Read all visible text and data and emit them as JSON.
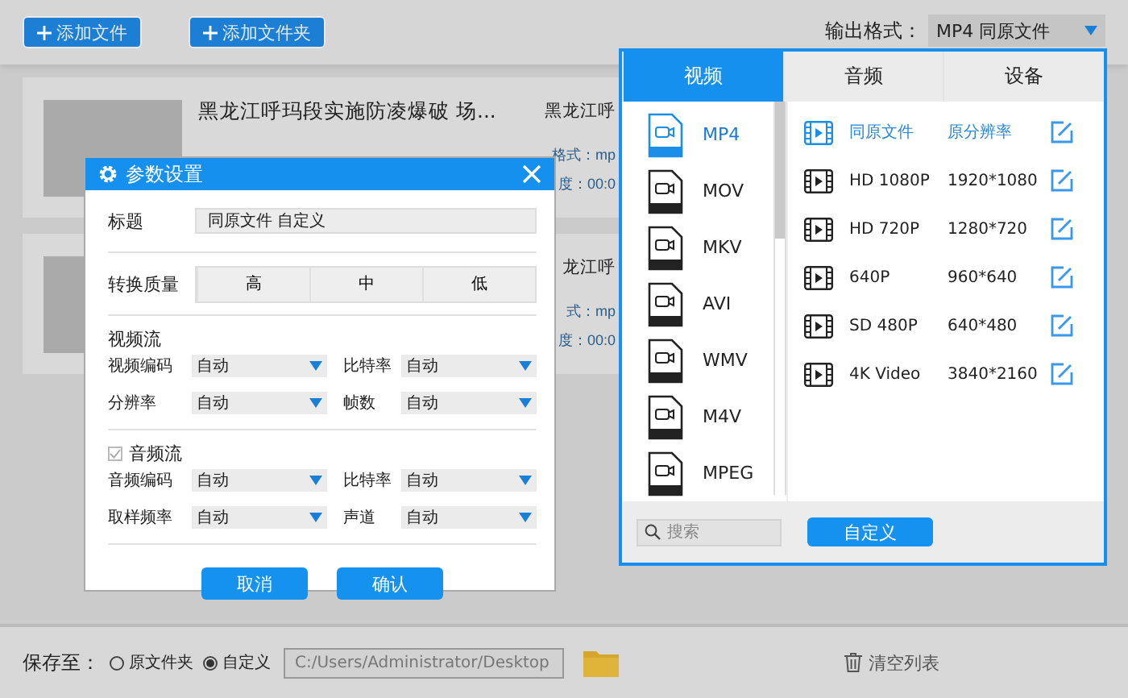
{
  "toolbar": {
    "buttons": [
      {
        "label": "添加文件"
      },
      {
        "label": "添加文件夹"
      }
    ],
    "output_format": {
      "label": "输出格式：",
      "value": "MP4  同原文件"
    }
  },
  "files": [
    {
      "title": "黑龙江呼玛段实施防凌爆破 场...",
      "title_2": "黑龙江呼",
      "detail": "格式：mp",
      "detail_2": "度：00:0"
    },
    {
      "title_2": "龙江呼",
      "detail": "式：mp",
      "detail_2": "度：00:0"
    }
  ],
  "format_panel": {
    "tabs": [
      {
        "label": "视频",
        "selected": true
      },
      {
        "label": "音频",
        "selected": false
      },
      {
        "label": "设备",
        "selected": false
      }
    ],
    "formats": [
      {
        "label": "MP4",
        "selected": true
      },
      {
        "label": "MOV",
        "selected": false
      },
      {
        "label": "MKV",
        "selected": false
      },
      {
        "label": "AVI",
        "selected": false
      },
      {
        "label": "WMV",
        "selected": false
      },
      {
        "label": "M4V",
        "selected": false
      },
      {
        "label": "MPEG",
        "selected": false
      }
    ],
    "presets": [
      {
        "name": "同原文件",
        "resolution": "原分辨率",
        "selected": true
      },
      {
        "name": "HD 1080P",
        "resolution": "1920*1080",
        "selected": false
      },
      {
        "name": "HD 720P",
        "resolution": "1280*720",
        "selected": false
      },
      {
        "name": "640P",
        "resolution": "960*640",
        "selected": false
      },
      {
        "name": "SD 480P",
        "resolution": "640*480",
        "selected": false
      },
      {
        "name": "4K Video",
        "resolution": "3840*2160",
        "selected": false
      }
    ],
    "search": {
      "placeholder": "搜索"
    },
    "custom_button": "自定义"
  },
  "settings_dialog": {
    "title": "参数设置",
    "title_field": {
      "label": "标题",
      "value": "同原文件 自定义"
    },
    "quality": {
      "label": "转换质量",
      "options": [
        "高",
        "中",
        "低"
      ]
    },
    "sections": [
      {
        "label": "视频流",
        "has_checkbox": false,
        "fields": [
          {
            "label": "视频编码",
            "value": "自动"
          },
          {
            "label": "比特率",
            "value": "自动"
          },
          {
            "label": "分辨率",
            "value": "自动"
          },
          {
            "label": "帧数",
            "value": "自动"
          }
        ]
      },
      {
        "label": "音频流",
        "has_checkbox": true,
        "checked": true,
        "fields": [
          {
            "label": "音频编码",
            "value": "自动"
          },
          {
            "label": "比特率",
            "value": "自动"
          },
          {
            "label": "取样频率",
            "value": "自动"
          },
          {
            "label": "声道",
            "value": "自动"
          }
        ]
      }
    ],
    "buttons": [
      "取消",
      "确认"
    ]
  },
  "bottom_bar": {
    "label": "保存至：",
    "options": [
      {
        "label": "原文件夹",
        "selected": false
      },
      {
        "label": "自定义",
        "selected": true
      }
    ],
    "path": "C:/Users/Administrator/Desktop",
    "clear_button": "清空列表"
  }
}
